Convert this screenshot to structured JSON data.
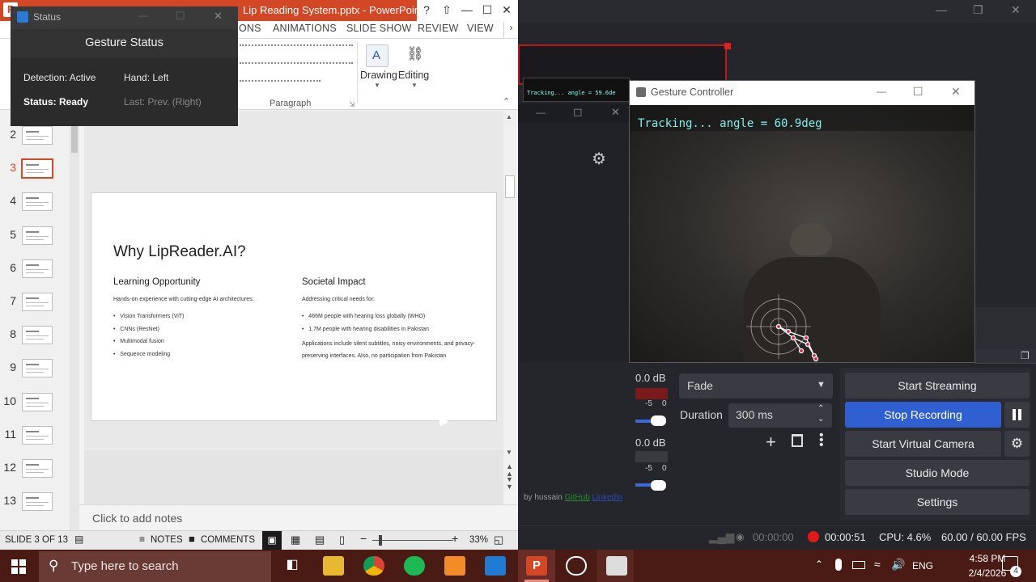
{
  "powerpoint": {
    "title": "Lip Reading System.pptx - PowerPoin…",
    "help": "?",
    "tabs": [
      "ONS",
      "ANIMATIONS",
      "SLIDE SHOW",
      "REVIEW",
      "VIEW"
    ],
    "ribbon": {
      "paragraph_label": "Paragraph",
      "drawing_label": "Drawing",
      "editing_label": "Editing"
    },
    "thumbnails": [
      "2",
      "3",
      "4",
      "5",
      "6",
      "7",
      "8",
      "9",
      "10",
      "11",
      "12",
      "13"
    ],
    "slide": {
      "title": "Why LipReader.AI?",
      "left_heading": "Learning Opportunity",
      "left_intro": "Hands-on experience with cutting-edge AI architectures:",
      "left_bullets": [
        "Vision Transformers (ViT)",
        "CNNs (ResNet)",
        "Multimodal fusion",
        "Sequence modeling"
      ],
      "right_heading": "Societal Impact",
      "right_intro": "Addressing critical needs for:",
      "right_bullets": [
        "466M people with hearing loss globally (WHO)",
        "1.7M people with hearing disabilities in Pakistan"
      ],
      "right_para": "Applications include silent subtitles, noisy environments, and privacy-preserving interfaces. Also, no participation from Pakistan"
    },
    "notes_placeholder": "Click to add notes",
    "status": {
      "slide": "SLIDE 3 OF 13",
      "notes": "NOTES",
      "comments": "COMMENTS",
      "zoom": "33%"
    }
  },
  "gesture_status": {
    "window_title": "Status",
    "heading": "Gesture Status",
    "detection": "Detection: Active",
    "hand": "Hand: Left",
    "status": "Status: Ready",
    "last": "Last: Prev. (Right)"
  },
  "gesture_controller": {
    "window_title": "Gesture Controller",
    "overlay": "Tracking... angle = 60.9deg",
    "tiny_overlay": "Tracking... angle = 59.6de"
  },
  "obs": {
    "mixer": [
      {
        "db": "0.0 dB",
        "scale_a": "-5",
        "scale_b": "0"
      },
      {
        "db": "0.0 dB",
        "scale_a": "-5",
        "scale_b": "0"
      }
    ],
    "transition": {
      "value": "Fade",
      "duration_label": "Duration",
      "duration_value": "300 ms"
    },
    "controls": {
      "start_streaming": "Start Streaming",
      "stop_recording": "Stop Recording",
      "start_virtual_camera": "Start Virtual Camera",
      "studio_mode": "Studio Mode",
      "settings": "Settings"
    },
    "credits": {
      "by": "by hussain",
      "github": "GitHub",
      "linkedin": "LinkedIn"
    },
    "status": {
      "stream_time": "00:00:00",
      "rec_time": "00:00:51",
      "cpu": "CPU: 4.6%",
      "fps": "60.00 / 60.00 FPS"
    },
    "accent": "#2f5fd1"
  },
  "taskbar": {
    "search_placeholder": "Type here to search",
    "lang": "ENG",
    "time": "4:58 PM",
    "date": "2/4/2026",
    "notif_count": "4"
  }
}
